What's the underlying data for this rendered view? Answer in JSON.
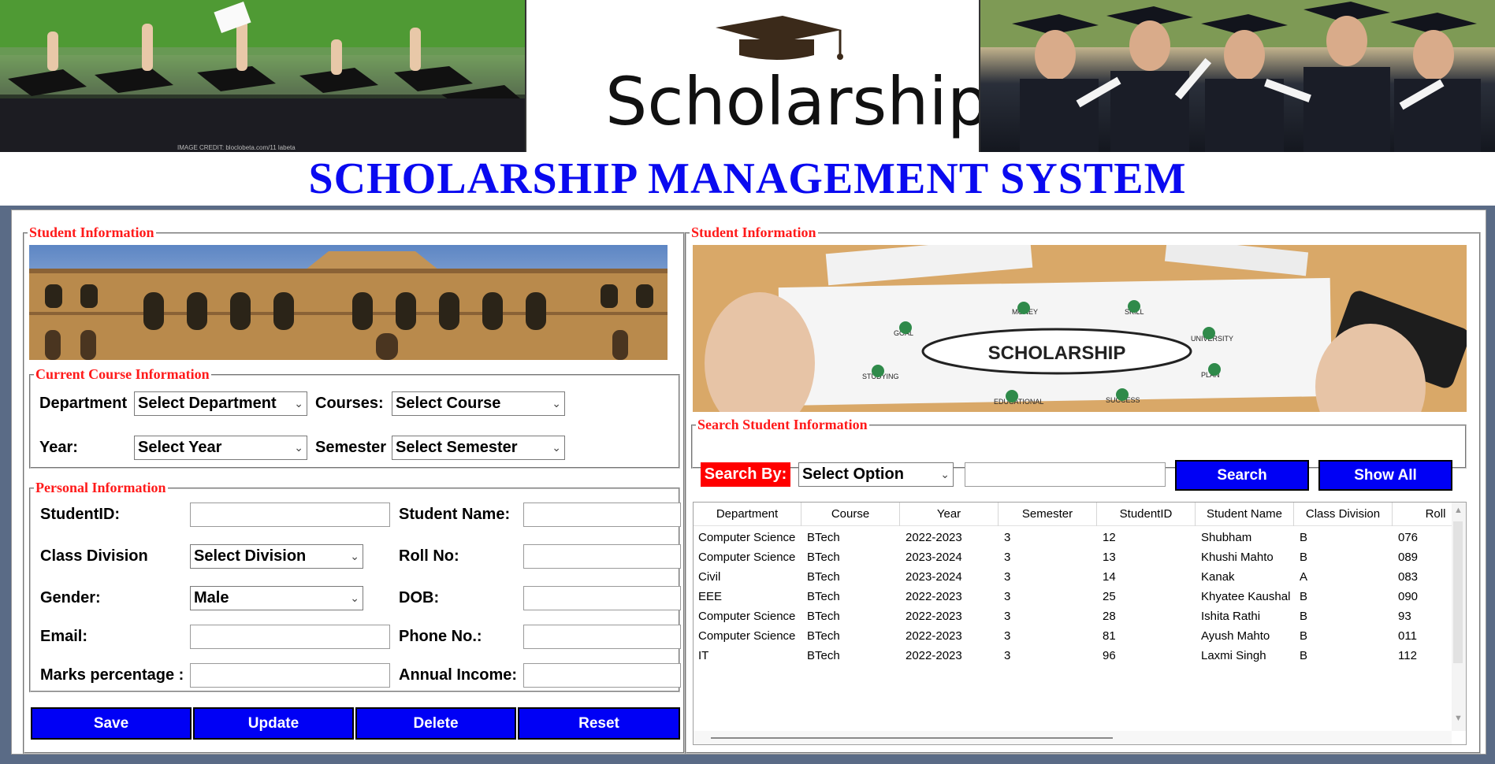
{
  "header": {
    "logo_text": "Scholarship",
    "left_image_caption": "IMAGE CREDIT: bloclobeta.com/11 labeta",
    "title": "SCHOLARSHIP MANAGEMENT SYSTEM"
  },
  "left_panel": {
    "student_info_legend": "Student Information",
    "course_legend": "Current Course Information",
    "department_label": "Department",
    "department_value": "Select Department",
    "courses_label": "Courses:",
    "courses_value": "Select Course",
    "year_label": "Year:",
    "year_value": "Select Year",
    "semester_label": "Semester",
    "semester_value": "Select Semester",
    "personal_legend": "Personal   Information",
    "student_id_label": "StudentID:",
    "student_name_label": "Student Name:",
    "class_division_label": "Class Division",
    "class_division_value": "Select Division",
    "roll_no_label": "Roll No:",
    "gender_label": "Gender:",
    "gender_value": "Male",
    "dob_label": "DOB:",
    "email_label": "Email:",
    "phone_label": "Phone No.:",
    "marks_label": "Marks percentage :",
    "income_label": "Annual Income:",
    "buttons": {
      "save": "Save",
      "update": "Update",
      "delete": "Delete",
      "reset": "Reset"
    }
  },
  "right_panel": {
    "student_info_legend": "Student Information",
    "scholarship_image_text": "SCHOLARSHIP",
    "image_labels": {
      "money": "MONEY",
      "skill": "SKILL",
      "goal": "GOAL",
      "university": "UNIVERSITY",
      "studying": "STUDYING",
      "plan": "PLAN",
      "educational": "EDUCATIONAL",
      "success": "SUCCESS"
    },
    "search_legend": "Search Student Information",
    "search_by_label": "Search By:",
    "search_option_value": "Select Option",
    "search_button": "Search",
    "show_all_button": "Show All",
    "table": {
      "columns": [
        "Department",
        "Course",
        "Year",
        "Semester",
        "StudentID",
        "Student Name",
        "Class Division",
        "Roll"
      ],
      "rows": [
        [
          "Computer Science",
          "BTech",
          "2022-2023",
          "3",
          "12",
          "Shubham",
          "B",
          "076"
        ],
        [
          "Computer Science",
          "BTech",
          "2023-2024",
          "3",
          "13",
          "Khushi Mahto",
          "B",
          "089"
        ],
        [
          "Civil",
          "BTech",
          "2023-2024",
          "3",
          "14",
          "Kanak",
          "A",
          "083"
        ],
        [
          "EEE",
          "BTech",
          "2022-2023",
          "3",
          "25",
          "Khyatee Kaushal",
          "B",
          "090"
        ],
        [
          "Computer Science",
          "BTech",
          "2022-2023",
          "3",
          "28",
          "Ishita Rathi",
          "B",
          "93"
        ],
        [
          "Computer Science",
          "BTech",
          "2022-2023",
          "3",
          "81",
          "Ayush Mahto",
          "B",
          "011"
        ],
        [
          "IT",
          "BTech",
          "2022-2023",
          "3",
          "96",
          "Laxmi Singh",
          "B",
          "112"
        ]
      ]
    }
  },
  "colors": {
    "title_blue": "#0a0af0",
    "button_blue": "#0000f5",
    "legend_red": "#ff1a1a",
    "search_by_red": "#ff0000"
  }
}
